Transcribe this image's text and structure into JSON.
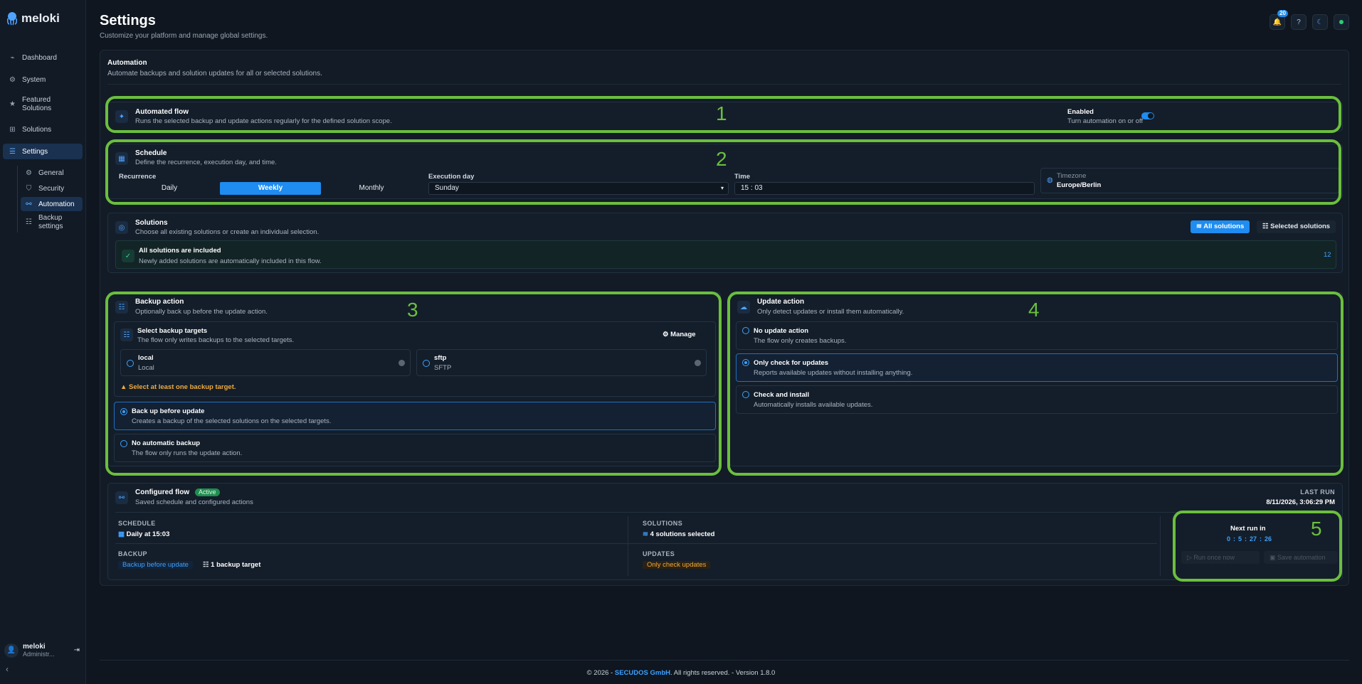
{
  "app": {
    "name": "meloki"
  },
  "nav": {
    "dashboard": "Dashboard",
    "system": "System",
    "featured": "Featured Solutions",
    "solutions": "Solutions",
    "settings": "Settings",
    "general": "General",
    "security": "Security",
    "automation": "Automation",
    "backup_settings": "Backup settings"
  },
  "user": {
    "name": "meloki",
    "role": "Administr..."
  },
  "header": {
    "title": "Settings",
    "subtitle": "Customize your platform and manage global settings.",
    "notifications": "20"
  },
  "automation": {
    "title": "Automation",
    "subtitle": "Automate backups and solution updates for all or selected solutions."
  },
  "flow": {
    "title": "Automated flow",
    "subtitle": "Runs the selected backup and update actions regularly for the defined solution scope.",
    "enabled_label": "Enabled",
    "enabled_sub": "Turn automation on or off",
    "enabled": true
  },
  "schedule": {
    "title": "Schedule",
    "subtitle": "Define the recurrence, execution day, and time.",
    "recurrence_label": "Recurrence",
    "recurrence_options": [
      "Daily",
      "Weekly",
      "Monthly"
    ],
    "recurrence_selected": "Weekly",
    "execution_day_label": "Execution day",
    "execution_day": "Sunday",
    "time_label": "Time",
    "time": "15 : 03",
    "timezone_label": "Timezone",
    "timezone": "Europe/Berlin"
  },
  "solutions": {
    "title": "Solutions",
    "subtitle": "Choose all existing solutions or create an individual selection.",
    "all_btn": "All solutions",
    "selected_btn": "Selected solutions",
    "included_title": "All solutions are included",
    "included_sub": "Newly added solutions are automatically included in this flow.",
    "count": "12"
  },
  "backup": {
    "title": "Backup action",
    "subtitle": "Optionally back up before the update action.",
    "targets_title": "Select backup targets",
    "targets_sub": "The flow only writes backups to the selected targets.",
    "manage": "Manage",
    "targets": [
      {
        "name": "local",
        "type": "Local"
      },
      {
        "name": "sftp",
        "type": "SFTP"
      }
    ],
    "warning": "Select at least one backup target.",
    "options": [
      {
        "title": "Back up before update",
        "sub": "Creates a backup of the selected solutions on the selected targets.",
        "selected": true
      },
      {
        "title": "No automatic backup",
        "sub": "The flow only runs the update action.",
        "selected": false
      }
    ]
  },
  "update": {
    "title": "Update action",
    "subtitle": "Only detect updates or install them automatically.",
    "options": [
      {
        "title": "No update action",
        "sub": "The flow only creates backups.",
        "selected": false
      },
      {
        "title": "Only check for updates",
        "sub": "Reports available updates without installing anything.",
        "selected": true
      },
      {
        "title": "Check and install",
        "sub": "Automatically installs available updates.",
        "selected": false
      }
    ]
  },
  "configured": {
    "title": "Configured flow",
    "status": "Active",
    "subtitle": "Saved schedule and configured actions",
    "last_run_label": "LAST RUN",
    "last_run": "8/11/2026, 3:06:29 PM",
    "schedule_label": "SCHEDULE",
    "schedule_val": "Daily at 15:03",
    "solutions_label": "SOLUTIONS",
    "solutions_val": "4 solutions selected",
    "backup_label": "BACKUP",
    "backup_val": "Backup before update",
    "backup_target": "1 backup target",
    "updates_label": "UPDATES",
    "updates_val": "Only check updates",
    "next_run_label": "Next run in",
    "countdown": [
      "0",
      "5",
      "27",
      "26"
    ],
    "run_once": "Run once now",
    "save": "Save automation"
  },
  "annotations": [
    "1",
    "2",
    "3",
    "4",
    "5"
  ],
  "footer": {
    "prefix": "© 2026 - ",
    "company": "SECUDOS GmbH",
    "suffix": ". All rights reserved. - Version 1.8.0"
  },
  "colors": {
    "accent": "#1e8cf0",
    "highlight": "#6bbf3d",
    "warning": "#f2a93b",
    "success": "#1f8f4f"
  }
}
